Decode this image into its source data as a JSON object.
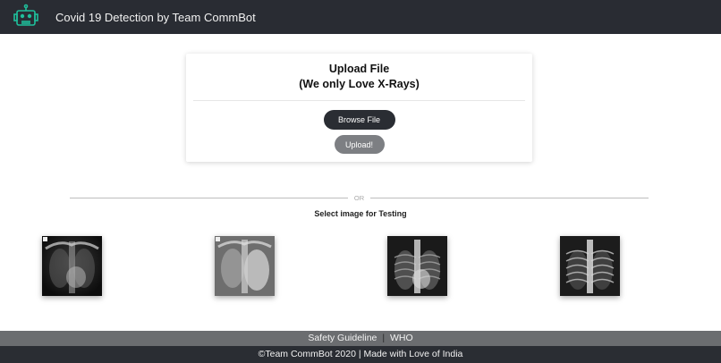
{
  "navbar": {
    "brand": "Covid 19 Detection by Team CommBot",
    "logo_icon": "robot-icon",
    "accent_color": "#1fbf9b"
  },
  "upload_card": {
    "title_line1": "Upload File",
    "title_line2": "(We only Love X-Rays)",
    "browse_label": "Browse File",
    "upload_label": "Upload!"
  },
  "divider": {
    "or_text": "OR"
  },
  "testing": {
    "label": "Select image for Testing",
    "images": [
      {
        "name": "test-xray-1"
      },
      {
        "name": "test-xray-2"
      },
      {
        "name": "test-xray-3"
      },
      {
        "name": "test-xray-4"
      }
    ]
  },
  "footer": {
    "safety_label": "Safety Guideline",
    "separator": "|",
    "who_label": "WHO",
    "copyright": "©Team CommBot 2020 | Made with Love of India"
  }
}
